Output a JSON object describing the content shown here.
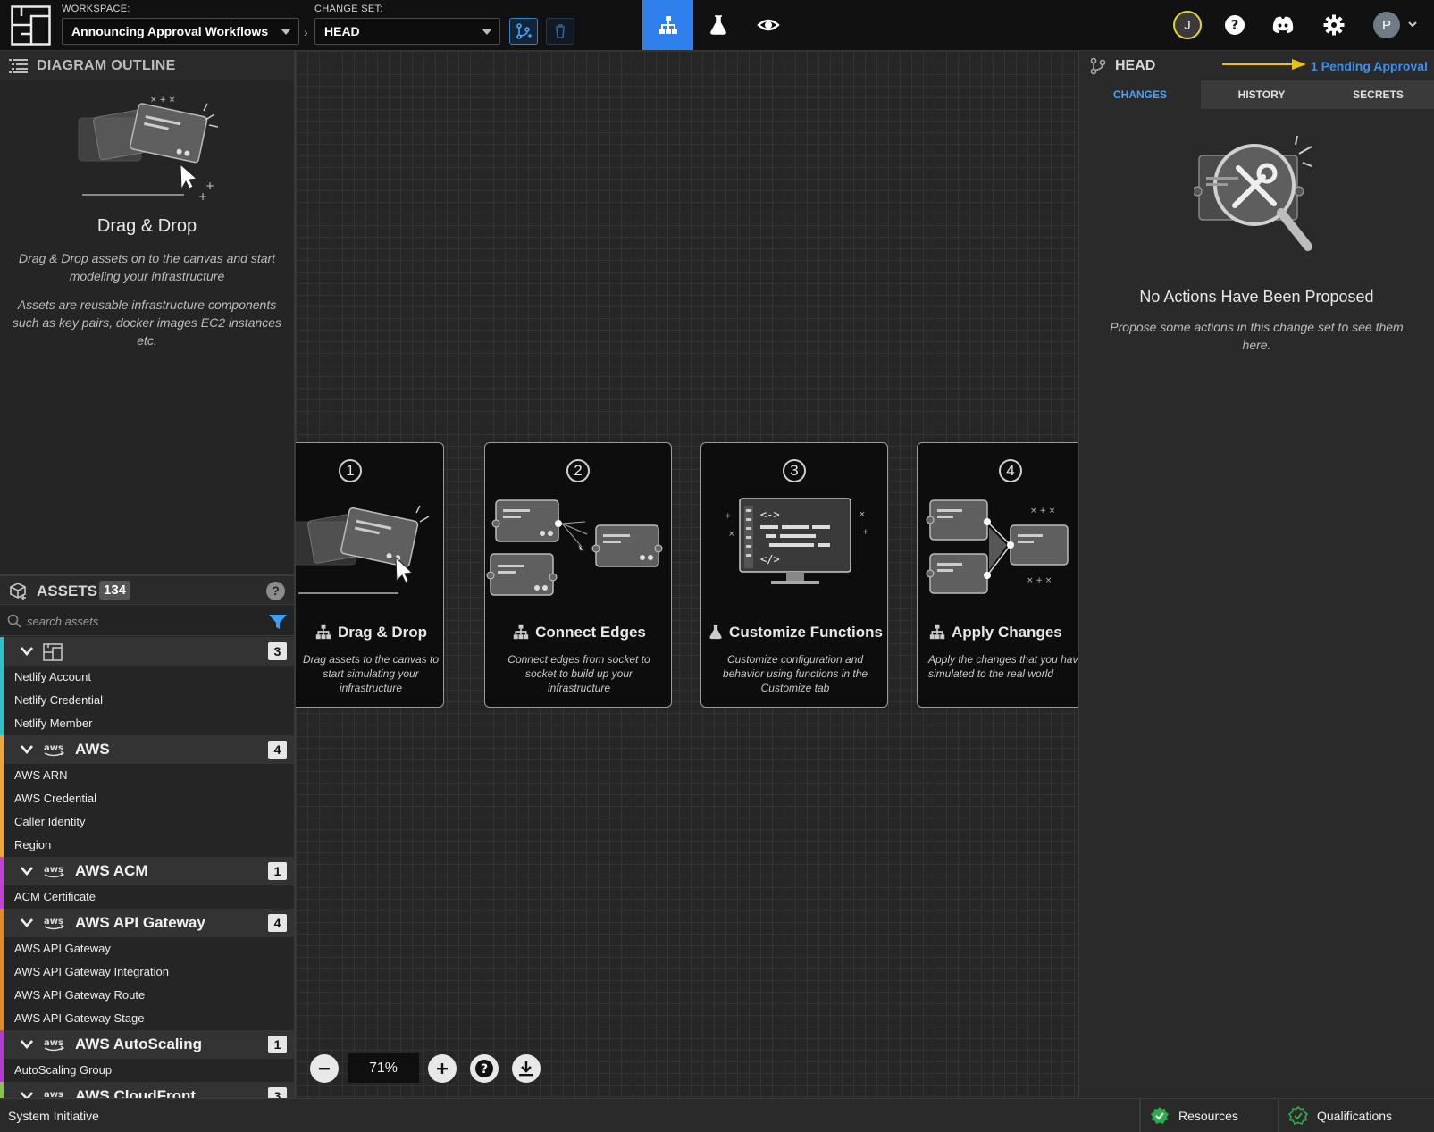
{
  "topbar": {
    "workspace_label": "WORKSPACE:",
    "workspace_value": "Announcing Approval Workflows",
    "changeset_label": "CHANGE SET:",
    "changeset_value": "HEAD",
    "user_initial": "J",
    "profile_initial": "P"
  },
  "outline": {
    "title": "DIAGRAM OUTLINE",
    "heading": "Drag & Drop",
    "paragraph1": "Drag & Drop assets on to the canvas and start modeling your infrastructure",
    "paragraph2": "Assets are reusable infrastructure components such as key pairs, docker images EC2 instances etc."
  },
  "assets": {
    "title": "ASSETS",
    "count": "134",
    "search_placeholder": "search assets",
    "categories": [
      {
        "name": "",
        "count": "3",
        "color": "#2fc1c5",
        "items": [
          "Netlify Account",
          "Netlify Credential",
          "Netlify Member"
        ]
      },
      {
        "name": "AWS",
        "count": "4",
        "color": "#f0a53a",
        "items": [
          "AWS ARN",
          "AWS Credential",
          "Caller Identity",
          "Region"
        ]
      },
      {
        "name": "AWS ACM",
        "count": "1",
        "color": "#c33fd6",
        "items": [
          "ACM Certificate"
        ]
      },
      {
        "name": "AWS API Gateway",
        "count": "4",
        "color": "#e58a2a",
        "items": [
          "AWS API Gateway",
          "AWS API Gateway Integration",
          "AWS API Gateway Route",
          "AWS API Gateway Stage"
        ]
      },
      {
        "name": "AWS AutoScaling",
        "count": "1",
        "color": "#b23bd0",
        "items": [
          "AutoScaling Group"
        ]
      },
      {
        "name": "AWS CloudFront",
        "count": "3",
        "color": "#8bc34a",
        "items": []
      }
    ]
  },
  "canvas": {
    "zoom": "71%",
    "cards": [
      {
        "num": "1",
        "title": "Drag & Drop",
        "desc": "Drag assets to the canvas to start simulating your infrastructure"
      },
      {
        "num": "2",
        "title": "Connect Edges",
        "desc": "Connect edges from socket to socket to build up your infrastructure"
      },
      {
        "num": "3",
        "title": "Customize Functions",
        "desc": "Customize configuration and behavior using functions in the Customize tab"
      },
      {
        "num": "4",
        "title": "Apply Changes",
        "desc": "Apply the changes that you have simulated to the real world"
      }
    ]
  },
  "right_panel": {
    "head": "HEAD",
    "pending": "1 Pending Approval",
    "tabs": [
      "CHANGES",
      "HISTORY",
      "SECRETS"
    ],
    "empty_title": "No Actions Have Been Proposed",
    "empty_desc": "Propose some actions in this change set to see them here."
  },
  "statusbar": {
    "brand": "System Initiative",
    "resources": "Resources",
    "qualifications": "Qualifications"
  }
}
